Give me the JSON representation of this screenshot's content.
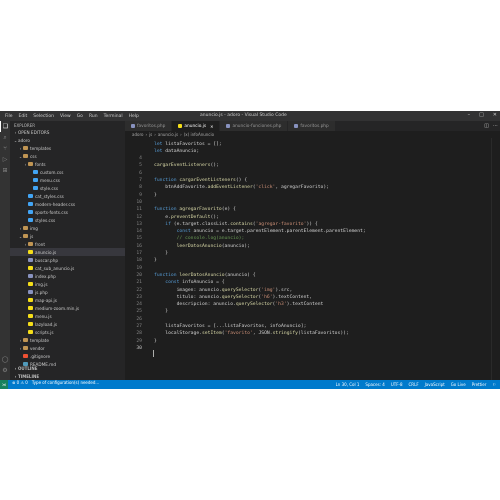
{
  "titlebar": {
    "menu": [
      "File",
      "Edit",
      "Selection",
      "View",
      "Go",
      "Run",
      "Terminal",
      "Help"
    ],
    "window_title": "anuncio.js - adoro - Visual Studio Code"
  },
  "sidebar": {
    "header": "EXPLORER",
    "items": [
      {
        "label": "OPEN EDITORS",
        "depth": 0,
        "arrow": "›",
        "kind": "section",
        "sel": false
      },
      {
        "label": "adoro",
        "depth": 0,
        "arrow": "⌄",
        "kind": "section",
        "sel": false
      },
      {
        "label": "templates",
        "depth": 1,
        "arrow": "›",
        "kind": "folder",
        "sel": false
      },
      {
        "label": "css",
        "depth": 1,
        "arrow": "⌄",
        "kind": "folder",
        "sel": false
      },
      {
        "label": "fonts",
        "depth": 2,
        "arrow": "›",
        "kind": "folder",
        "sel": false
      },
      {
        "label": "custom.css",
        "depth": 3,
        "arrow": "",
        "kind": "css",
        "sel": false
      },
      {
        "label": "menu.css",
        "depth": 3,
        "arrow": "",
        "kind": "css",
        "sel": false
      },
      {
        "label": "style.css",
        "depth": 3,
        "arrow": "",
        "kind": "css",
        "sel": false
      },
      {
        "label": "cat_styles.css",
        "depth": 2,
        "arrow": "",
        "kind": "css",
        "sel": false
      },
      {
        "label": "modern-header.css",
        "depth": 2,
        "arrow": "",
        "kind": "css",
        "sel": false
      },
      {
        "label": "sports-fonts.css",
        "depth": 2,
        "arrow": "",
        "kind": "css",
        "sel": false
      },
      {
        "label": "styles.css",
        "depth": 2,
        "arrow": "",
        "kind": "css",
        "sel": false
      },
      {
        "label": "img",
        "depth": 1,
        "arrow": "›",
        "kind": "folder",
        "sel": false
      },
      {
        "label": "js",
        "depth": 1,
        "arrow": "⌄",
        "kind": "folder",
        "sel": false
      },
      {
        "label": "front",
        "depth": 2,
        "arrow": "›",
        "kind": "folder",
        "sel": false
      },
      {
        "label": "anuncio.js",
        "depth": 2,
        "arrow": "",
        "kind": "js",
        "sel": true
      },
      {
        "label": "buscar.php",
        "depth": 2,
        "arrow": "",
        "kind": "php",
        "sel": false
      },
      {
        "label": "cat_sub_anuncio.js",
        "depth": 2,
        "arrow": "",
        "kind": "js",
        "sel": false
      },
      {
        "label": "index.php",
        "depth": 2,
        "arrow": "",
        "kind": "php",
        "sel": false
      },
      {
        "label": "img.js",
        "depth": 2,
        "arrow": "",
        "kind": "js",
        "sel": false
      },
      {
        "label": "js.php",
        "depth": 2,
        "arrow": "",
        "kind": "php",
        "sel": false
      },
      {
        "label": "map-api.js",
        "depth": 2,
        "arrow": "",
        "kind": "js",
        "sel": false
      },
      {
        "label": "medium-zoom.min.js",
        "depth": 2,
        "arrow": "",
        "kind": "js",
        "sel": false
      },
      {
        "label": "menu.js",
        "depth": 2,
        "arrow": "",
        "kind": "js",
        "sel": false
      },
      {
        "label": "lazyload.js",
        "depth": 2,
        "arrow": "",
        "kind": "js",
        "sel": false
      },
      {
        "label": "scripts.js",
        "depth": 2,
        "arrow": "",
        "kind": "js",
        "sel": false
      },
      {
        "label": "template",
        "depth": 1,
        "arrow": "›",
        "kind": "folder",
        "sel": false
      },
      {
        "label": "vendor",
        "depth": 1,
        "arrow": "›",
        "kind": "folder",
        "sel": false
      },
      {
        "label": ".gitignore",
        "depth": 1,
        "arrow": "",
        "kind": "git",
        "sel": false
      },
      {
        "label": "README.md",
        "depth": 1,
        "arrow": "",
        "kind": "md",
        "sel": false
      }
    ],
    "outline": [
      "OUTLINE",
      "TIMELINE"
    ]
  },
  "tabs": [
    {
      "label": "favoritos.php",
      "kind": "php",
      "active": false
    },
    {
      "label": "anuncio.js",
      "kind": "js",
      "active": true
    },
    {
      "label": "anuncio-funciones.php",
      "kind": "php",
      "active": false
    },
    {
      "label": "favoritos.php",
      "kind": "php",
      "active": false
    }
  ],
  "breadcrumb": [
    "adoro",
    "js",
    "anuncio.js",
    "(x) infoAnuncio"
  ],
  "editor": {
    "lines": [
      {
        "n": "",
        "t": "let listaFavoritos = [];"
      },
      {
        "n": "",
        "t": "let dataAnuncio;"
      },
      {
        "n": "4",
        "t": ""
      },
      {
        "n": "5",
        "t": "cargarEventListeners();"
      },
      {
        "n": "6",
        "t": ""
      },
      {
        "n": "7",
        "t": "function cargarEventListeners() {"
      },
      {
        "n": "8",
        "t": "    btnAddFavorite.addEventListener('click', agregarFavorito);"
      },
      {
        "n": "9",
        "t": "}"
      },
      {
        "n": "10",
        "t": ""
      },
      {
        "n": "11",
        "t": "function agregarFavorito(e) {"
      },
      {
        "n": "12",
        "t": "    e.preventDefault();"
      },
      {
        "n": "13",
        "t": "    if (e.target.classList.contains('agregar-favorito')) {"
      },
      {
        "n": "14",
        "t": "        const anuncio = e.target.parentElement.parentElement.parentElement;"
      },
      {
        "n": "15",
        "t": "        // console.log(anuncio);"
      },
      {
        "n": "16",
        "t": "        leerDatosAnuncio(anuncio);"
      },
      {
        "n": "17",
        "t": "    }"
      },
      {
        "n": "18",
        "t": "}"
      },
      {
        "n": "19",
        "t": ""
      },
      {
        "n": "20",
        "t": "function leerDatosAnuncio(anuncio) {"
      },
      {
        "n": "21",
        "t": "    const infoAnuncio = {"
      },
      {
        "n": "22",
        "t": "        imagen: anuncio.querySelector('img').src,"
      },
      {
        "n": "23",
        "t": "        titulo: anuncio.querySelector('h6').textContent,"
      },
      {
        "n": "24",
        "t": "        descripcion: anuncio.querySelector('h3').textContent"
      },
      {
        "n": "25",
        "t": "    }"
      },
      {
        "n": "26",
        "t": ""
      },
      {
        "n": "27",
        "t": "    listaFavoritos = [...listaFavoritos, infoAnuncio];"
      },
      {
        "n": "28",
        "t": "    localStorage.setItem('favorito', JSON.stringify(listaFavoritos));"
      },
      {
        "n": "29",
        "t": "}"
      },
      {
        "n": "30",
        "t": ""
      }
    ]
  },
  "statusbar": {
    "remote": "⋊",
    "left": [
      "⊗ 0 ⚠ 0",
      "Type of configuration(s) needed..."
    ],
    "right": [
      "Ln 30, Col 1",
      "Spaces: 4",
      "UTF-8",
      "CRLF",
      "JavaScript",
      "Go Live",
      "Prettier",
      "⚐"
    ]
  }
}
